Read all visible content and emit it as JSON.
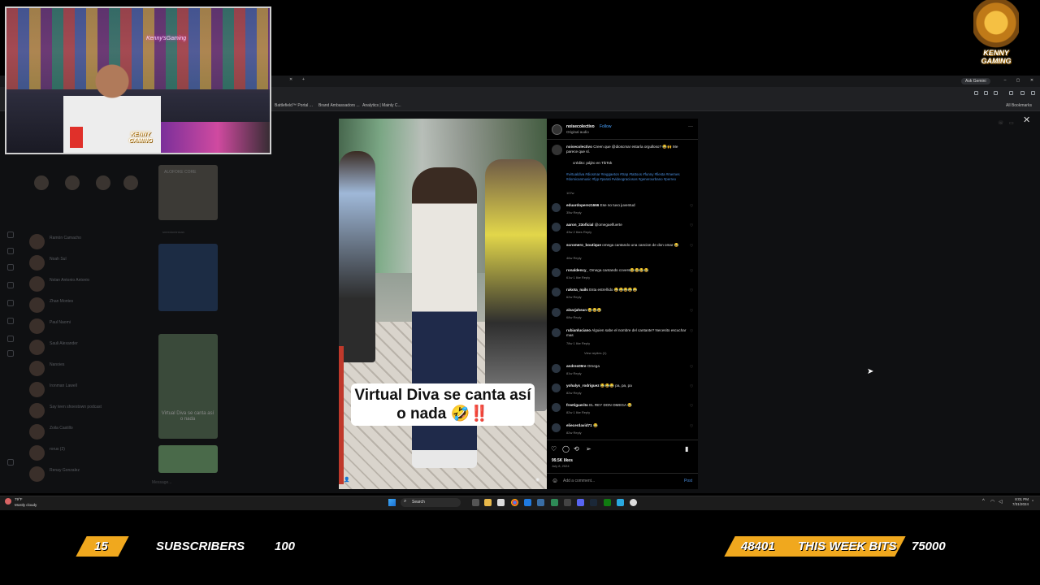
{
  "browser": {
    "ask_gemini": "Ask Gemini",
    "bookmarks": [
      "Battlefield™ Portal ...",
      "Brand Ambassadors ...",
      "Analytics | Mainly C..."
    ],
    "all_bookmarks": "All Bookmarks"
  },
  "dimmed_page": {
    "card1_label": "ALOFOKE CORE",
    "card2_name": "sneedominican",
    "card3_label": "Virtual Diva se canta así o nada",
    "message_placeholder": "Message...",
    "dm_names": [
      "Ramón Camacho",
      "Noah Sul",
      "Nolan Antonio Antonio",
      "Zhan Montes",
      "Paul Naomi",
      "Sauli Alexander",
      "Nanoies",
      "Ironman Lawell",
      "Say teen shoestown podcast",
      "Zoila Castillo",
      "rorus (2)",
      "Renay Gonzalez"
    ]
  },
  "post": {
    "username": "noisecolectivo",
    "follow": "Follow",
    "audio": "Original audio",
    "video_caption": "Virtual Diva se canta así o nada 🤣‼️",
    "caption_text": "Creen que @dioscmar estaría orgulloso? 😂🙌 Me parece que sí.",
    "caption_credit": "crédito: pájiro en TikTok",
    "caption_tags": "#virtualdiva #diosmar #reggaeton #trap #tattoos #funny #fiesta #memes #domicanmusic #fyp #parati #videograciosos #generourbano #perreo",
    "caption_age": "107w",
    "likes": "99.5K likes",
    "date": "July 8, 2024",
    "add_comment": "Add a comment...",
    "post_label": "Post",
    "comments": [
      {
        "user": "eduardoperez1666",
        "text": "Ese no tuvo juventud",
        "meta": "35w   Reply"
      },
      {
        "user": "aaron_23oficial",
        "text": "@omegaelfuerte",
        "meta": "43w   2 likes   Reply"
      },
      {
        "user": "scromero_boutique",
        "text": "omega cantando una cancion de don omar 😂",
        "meta": "46w   Reply"
      },
      {
        "user": "ronaldency_",
        "text": "Omega cantando covers😂😂😂😂",
        "meta": "61w   1 like   Reply"
      },
      {
        "user": "rakota_nails",
        "text": "Esta estreñido 😂😂😂😂😂",
        "meta": "62w   Reply"
      },
      {
        "user": "alzarjahean",
        "text": "😂😂😂",
        "meta": "68w   Reply"
      },
      {
        "user": "rubianluciano",
        "text": "Alguien sabe el nombre del cantante? Necesito escuchar mas",
        "meta": "78w   1 like   Reply"
      },
      {
        "user": "andres09re",
        "text": "Omega",
        "meta": "81w   Reply"
      },
      {
        "user": "yohalys_rodriguez",
        "text": "😂😂😂 pa, pa, pa",
        "meta": "82w   Reply"
      },
      {
        "user": "freetiguerito",
        "text": "EL REY DON OMEGA 😂",
        "meta": "82w   1 like   Reply"
      },
      {
        "user": "eliecerdavid71",
        "text": "😂",
        "meta": "82w   Reply"
      }
    ],
    "view_replies": "View replies (1)"
  },
  "taskbar": {
    "temp": "79°F",
    "weather": "Mostly cloudy",
    "search": "Search",
    "time": "8:01 PM",
    "date": "7/31/2024"
  },
  "stream": {
    "cam_neon": "Kenny'sGaming",
    "logo_line1": "KENNY",
    "logo_line2": "GAMING",
    "subs_current": "15",
    "subs_label": "SUBSCRIBERS",
    "subs_goal": "100",
    "bits_current": "48401",
    "bits_label": "THIS WEEK BITS",
    "bits_goal": "75000"
  },
  "colors": {
    "accent": "#f0a81e",
    "link": "#4a8fe0"
  }
}
